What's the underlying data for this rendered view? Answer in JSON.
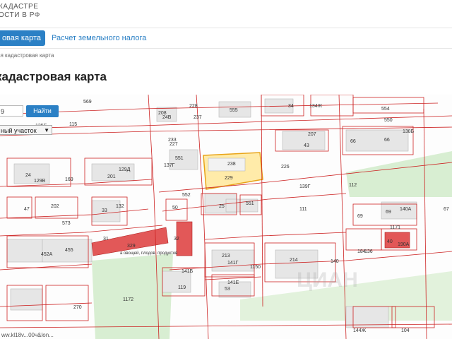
{
  "header": {
    "brand_line1": "КАДАСТРЕ",
    "brand_line2": "ОСТИ В РФ"
  },
  "tabs": [
    {
      "label": "овая карта",
      "active": true
    },
    {
      "label": "Расчет земельного налога",
      "active": false
    }
  ],
  "breadcrumb": "ая кадастровая карта",
  "page_title": "кадастровая карта",
  "map": {
    "search_value": "9",
    "search_button": "Найти",
    "select_value": "ный участок",
    "watermark": "ЦИАН",
    "footer_url": "ww.kl18v...00ч&lon...",
    "labels": [
      "569",
      "208",
      "228",
      "555",
      "34",
      "134Ж",
      "554",
      "550",
      "115",
      "24В",
      "237",
      "125Е",
      "227",
      "551",
      "238",
      "226",
      "207",
      "43",
      "66",
      "138Б",
      "137Г",
      "66",
      "233",
      "24",
      "129В",
      "169",
      "201",
      "129Д",
      "552",
      "229",
      "139Г",
      "112",
      "202",
      "47",
      "50",
      "25",
      "551",
      "111",
      "69",
      "140А",
      "67",
      "573",
      "132",
      "33",
      "1171",
      "31",
      "32",
      "329",
      "452А",
      "455",
      "213",
      "214",
      "40",
      "190A",
      "141Г",
      "1150",
      "184",
      "136",
      "270",
      "119",
      "53",
      "1172",
      "141Е",
      "141Б",
      "140",
      "144Ж",
      "104"
    ],
    "label_329_caption": "а овощей, плодов, продуктов",
    "colors": {
      "highlight": "#ffe08a",
      "highlight_stroke": "#e8a317",
      "parcel": "#cc2222",
      "building": "#e04848",
      "green": "#d4ecd0"
    }
  }
}
